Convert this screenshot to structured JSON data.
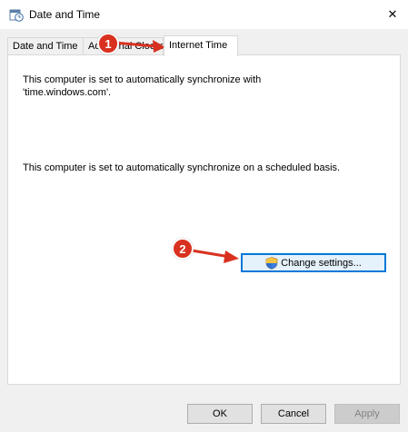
{
  "window": {
    "title": "Date and Time",
    "close_glyph": "✕"
  },
  "tabs": [
    {
      "label": "Date and Time",
      "active": false
    },
    {
      "label": "Additional Clocks",
      "active": false
    },
    {
      "label": "Internet Time",
      "active": true
    }
  ],
  "panel": {
    "sync_text_line1": "This computer is set to automatically synchronize with",
    "sync_text_line2": "'time.windows.com'.",
    "schedule_text": "This computer is set to automatically synchronize on a scheduled basis.",
    "change_settings_label": "Change settings..."
  },
  "buttons": {
    "ok": "OK",
    "cancel": "Cancel",
    "apply": "Apply"
  },
  "annotations": {
    "badge1": "1",
    "badge2": "2",
    "badge_color": "#d9311f",
    "arrow_color": "#d9311f"
  },
  "icons": {
    "title_icon": "date-time-icon",
    "uac_icon": "uac-shield-icon"
  }
}
